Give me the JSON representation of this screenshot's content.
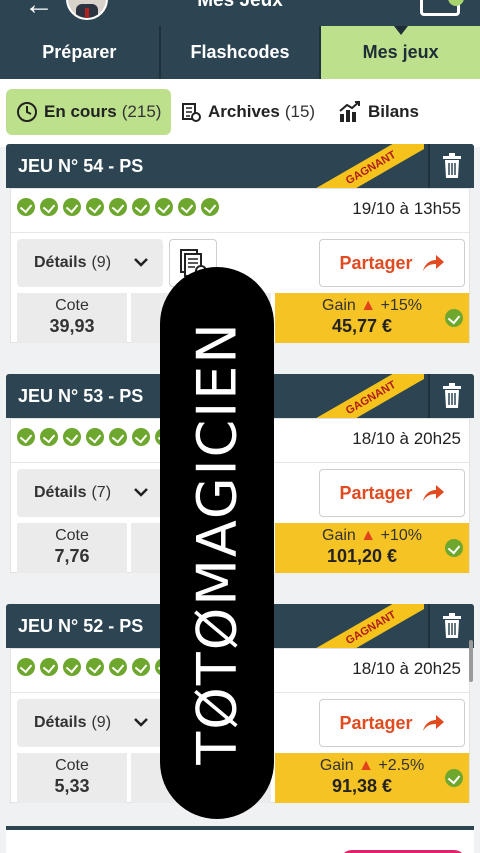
{
  "header": {
    "title": "Mes Jeux"
  },
  "tabs": [
    {
      "label": "Préparer"
    },
    {
      "label": "Flashcodes"
    },
    {
      "label": "Mes jeux"
    }
  ],
  "subtabs": {
    "en_cours": {
      "label": "En cours",
      "count": "(215)"
    },
    "archives": {
      "label": "Archives",
      "count": "(15)"
    },
    "bilans": {
      "label": "Bilans"
    }
  },
  "games": [
    {
      "title": "JEU N° 54 - PS",
      "badge": "GAGNANT",
      "checks": 9,
      "datetime": "19/10 à 13h55",
      "details_label": "Détails",
      "details_count": "(9)",
      "share_label": "Partager",
      "cote_label": "Cote",
      "cote_value": "39,93",
      "gain_label": "Gain",
      "gain_pct": "+15%",
      "gain_value": "45,77 €"
    },
    {
      "title": "JEU N° 53 - PS",
      "badge": "GAGNANT",
      "checks": 7,
      "datetime": "18/10 à 20h25",
      "details_label": "Détails",
      "details_count": "(7)",
      "share_label": "Partager",
      "cote_label": "Cote",
      "cote_value": "7,76",
      "gain_label": "Gain",
      "gain_pct": "+10%",
      "gain_value": "101,20 €"
    },
    {
      "title": "JEU N° 52 - PS",
      "badge": "GAGNANT",
      "checks": 7,
      "datetime": "18/10 à 20h25",
      "details_label": "Détails",
      "details_count": "(9)",
      "share_label": "Partager",
      "cote_label": "Cote",
      "cote_value": "5,33",
      "gain_label": "Gain",
      "gain_pct": "+2.5%",
      "gain_value": "91,38 €"
    }
  ],
  "watermark": "TØTØMAGICIEN",
  "colors": {
    "header_bg": "#2d4553",
    "accent_green": "#bde08d",
    "gain_yellow": "#f6c325",
    "share_orange": "#e04b20",
    "check_green": "#6ea72e"
  }
}
